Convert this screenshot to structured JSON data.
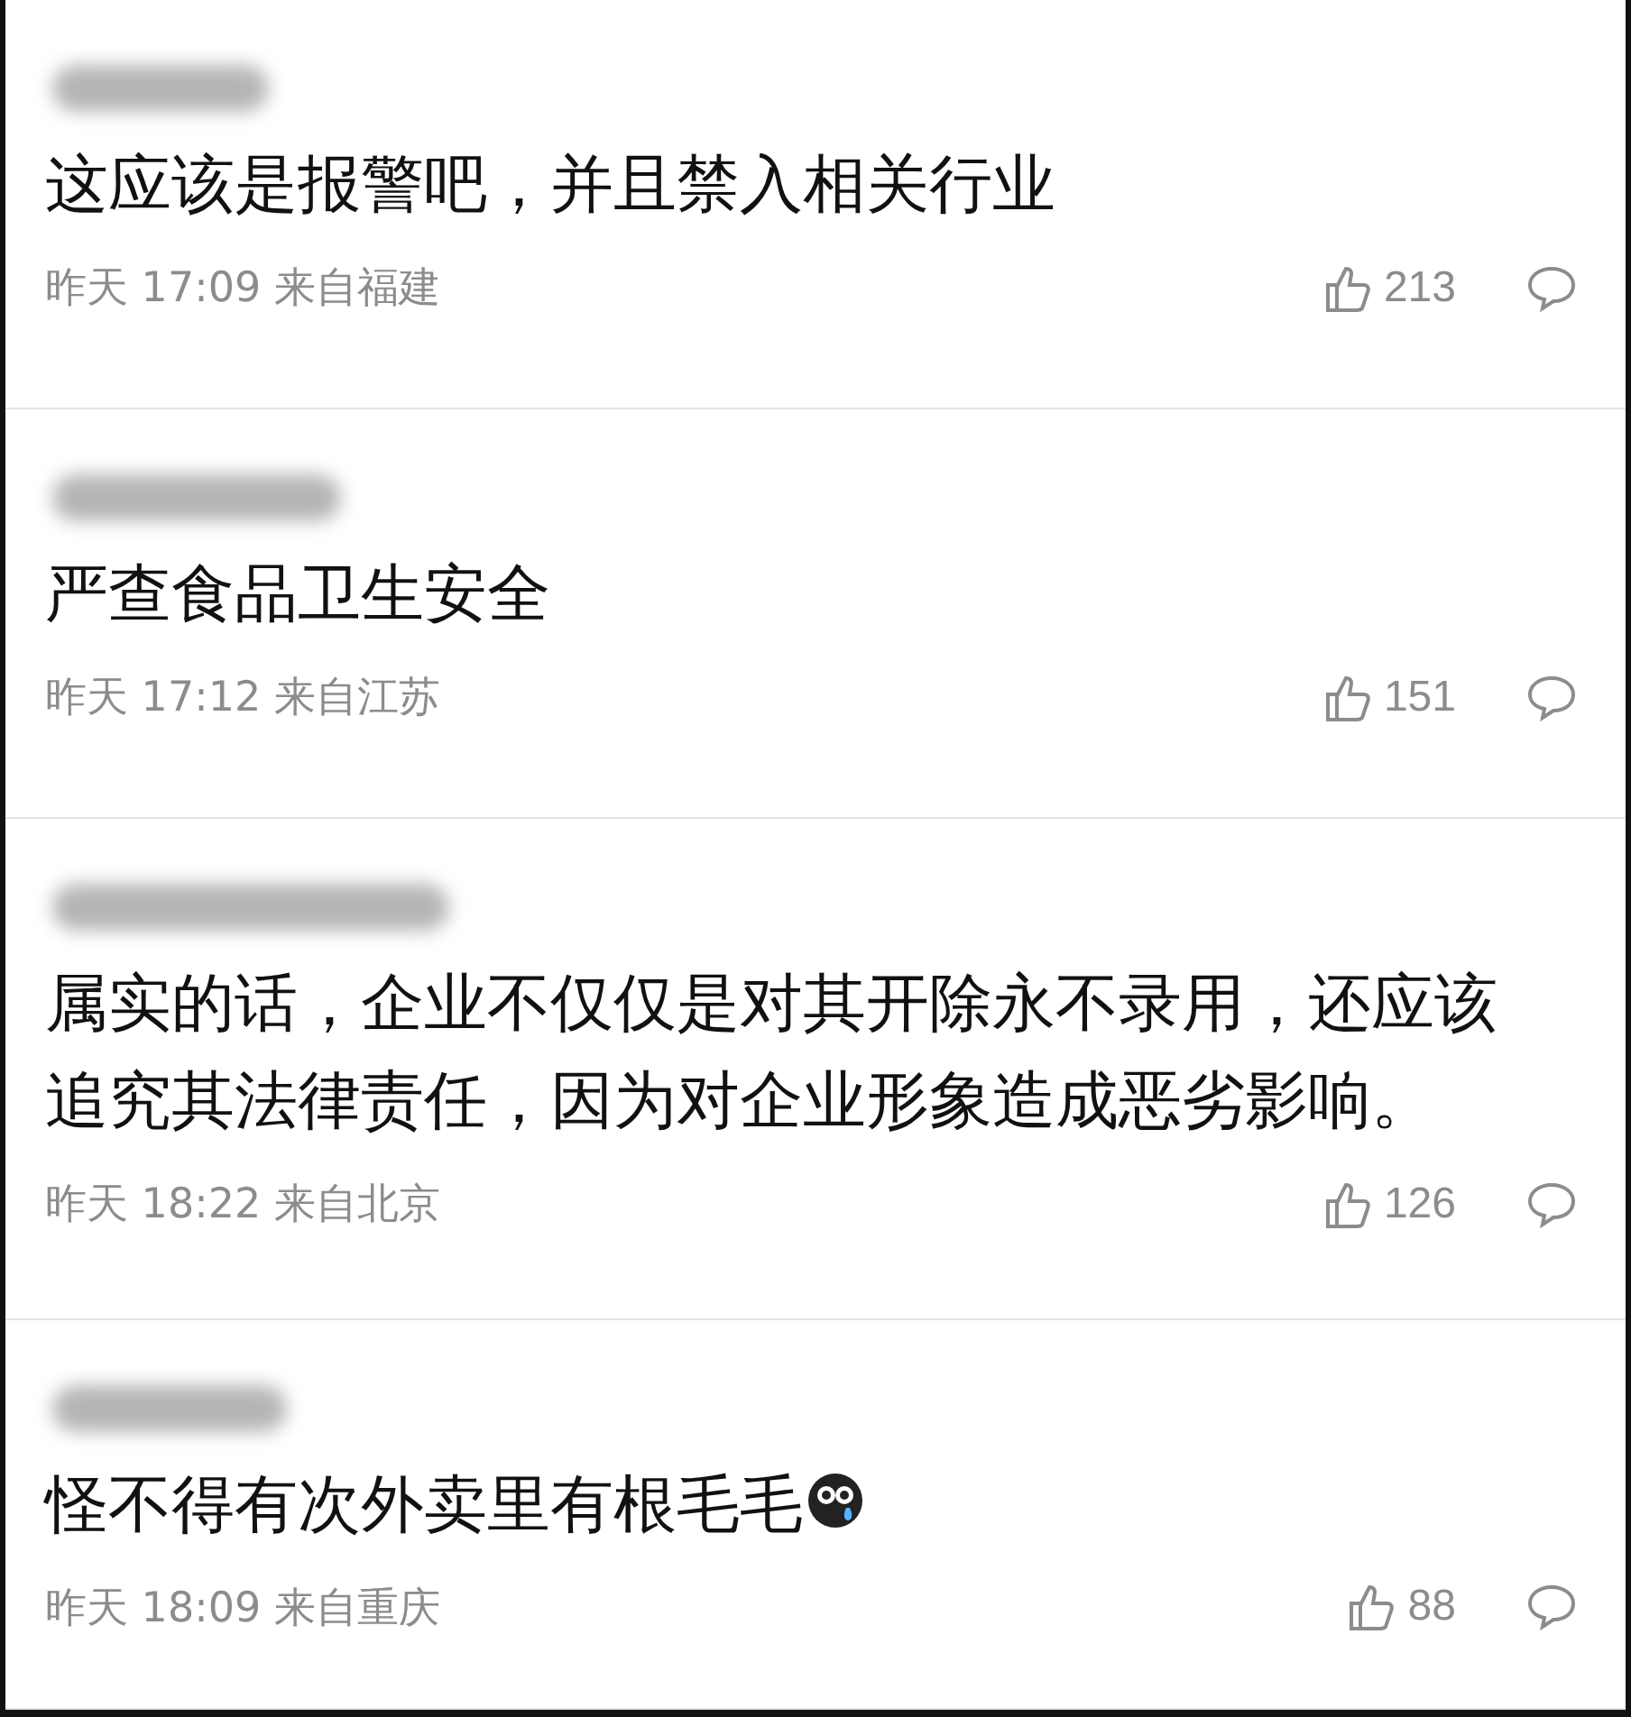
{
  "comments": [
    {
      "text": "这应该是报警吧，并且禁入相关行业",
      "emoji": false,
      "meta": "昨天 17:09 来自福建",
      "likes": "213"
    },
    {
      "text": "严查食品卫生安全",
      "emoji": false,
      "meta": "昨天 17:12 来自江苏",
      "likes": "151"
    },
    {
      "text": "属实的话，企业不仅仅是对其开除永不录用，还应该追究其法律责任，因为对企业形象造成恶劣影响。",
      "emoji": false,
      "meta": "昨天 18:22 来自北京",
      "likes": "126"
    },
    {
      "text": "怪不得有次外卖里有根毛毛",
      "emoji": true,
      "meta": "昨天 18:09 来自重庆",
      "likes": "88"
    }
  ]
}
